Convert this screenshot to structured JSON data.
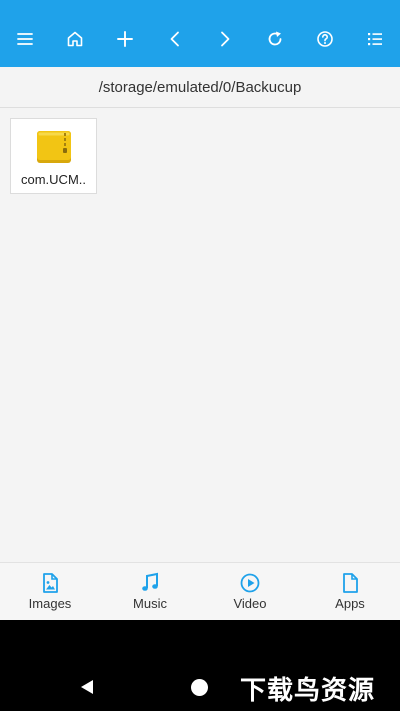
{
  "toolbar": {
    "background": "#1fa2ea",
    "buttons": [
      {
        "icon": "menu-icon"
      },
      {
        "icon": "home-icon"
      },
      {
        "icon": "plus-icon"
      },
      {
        "icon": "chevron-left-icon"
      },
      {
        "icon": "chevron-right-icon"
      },
      {
        "icon": "refresh-icon"
      },
      {
        "icon": "help-icon"
      },
      {
        "icon": "list-view-icon"
      }
    ]
  },
  "path": "/storage/emulated/0/Backucup",
  "files": [
    {
      "name": "com.UCM..",
      "icon": "folder-zip-icon",
      "color": "#f2c514"
    }
  ],
  "bottom_nav": {
    "accent": "#1fa2ea",
    "items": [
      {
        "label": "Images",
        "icon": "image-file-icon"
      },
      {
        "label": "Music",
        "icon": "music-note-icon"
      },
      {
        "label": "Video",
        "icon": "play-circle-icon"
      },
      {
        "label": "Apps",
        "icon": "document-icon"
      }
    ]
  },
  "system_nav": {
    "watermark": "下载鸟资源"
  }
}
